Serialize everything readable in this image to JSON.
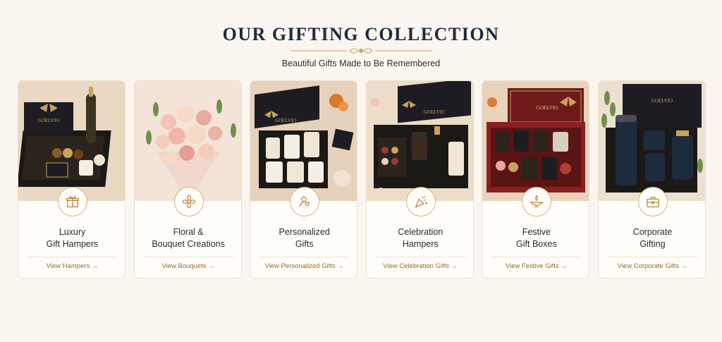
{
  "section": {
    "title": "OUR GIFTING COLLECTION",
    "subtitle": "Beautiful Gifts Made to Be Remembered"
  },
  "colors": {
    "background": "#fbf6f0",
    "heading": "#1f2a3d",
    "gold": "#c9a25e",
    "link": "#9a6a2a"
  },
  "brand_mark": "GOELVIO",
  "cards": [
    {
      "title_line1": "Luxury",
      "title_line2": "Gift Hampers",
      "link": "View Hampers →",
      "icon": "gift-icon"
    },
    {
      "title_line1": "Floral &",
      "title_line2": "Bouquet Creations",
      "link": "View Bouquets →",
      "icon": "flower-icon"
    },
    {
      "title_line1": "Personalized",
      "title_line2": "Gifts",
      "link": "View Personalized Gifts →",
      "icon": "person-heart-icon"
    },
    {
      "title_line1": "Celebration",
      "title_line2": "Hampers",
      "link": "View Celebration Gifts →",
      "icon": "party-popper-icon"
    },
    {
      "title_line1": "Festive",
      "title_line2": "Gift Boxes",
      "link": "View Festive Gifts →",
      "icon": "diya-lamp-icon"
    },
    {
      "title_line1": "Corporate",
      "title_line2": "Gifting",
      "link": "View Corporate Gifts →",
      "icon": "briefcase-icon"
    }
  ]
}
